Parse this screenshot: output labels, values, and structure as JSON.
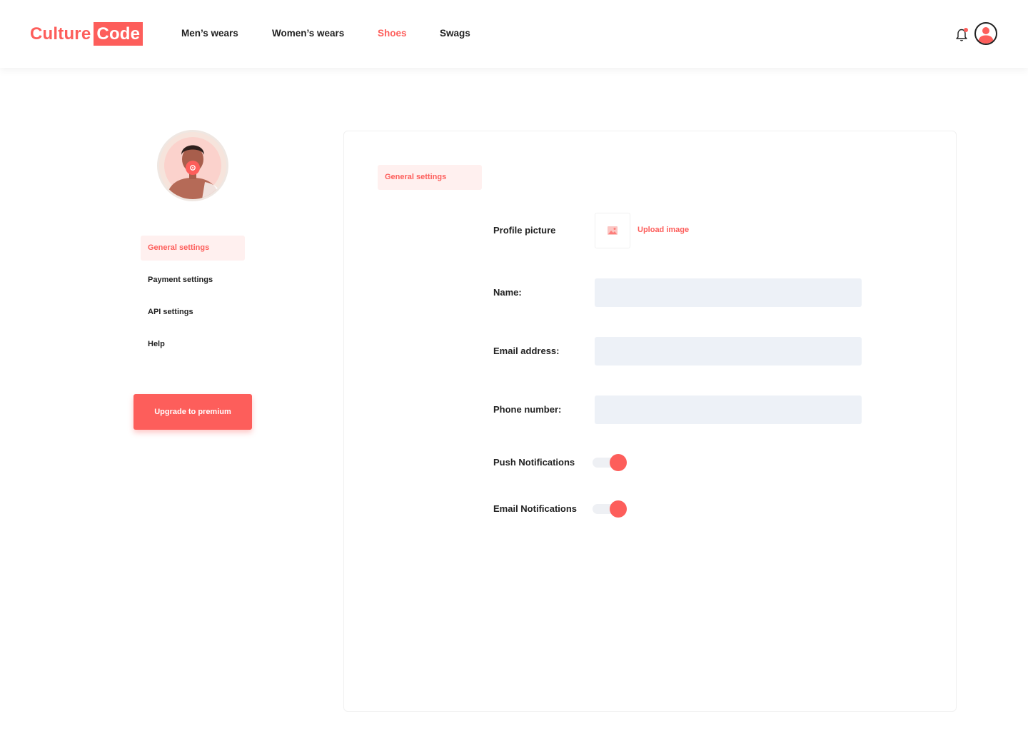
{
  "header": {
    "logo_part1": "Culture",
    "logo_part2": "Code",
    "nav": [
      {
        "label": "Men’s wears",
        "active": false
      },
      {
        "label": "Women’s wears",
        "active": false
      },
      {
        "label": "Shoes",
        "active": true
      },
      {
        "label": "Swags",
        "active": false
      }
    ],
    "icons": {
      "notification": "bell-icon",
      "account": "user-avatar-icon"
    },
    "has_unread_notification": true
  },
  "sidebar": {
    "items": [
      {
        "label": "General settings",
        "active": true
      },
      {
        "label": "Payment settings",
        "active": false
      },
      {
        "label": "API settings",
        "active": false
      },
      {
        "label": "Help",
        "active": false
      }
    ],
    "upgrade_label": "Upgrade to premium"
  },
  "main": {
    "tab_label": "General settings",
    "profile_picture_label": "Profile picture",
    "upload_label": "Upload image",
    "name_label": "Name:",
    "name_value": "",
    "email_label": "Email address:",
    "email_value": "",
    "phone_label": "Phone number:",
    "phone_value": "",
    "push_label": "Push Notifications",
    "push_enabled": true,
    "email_notif_label": "Email Notifications",
    "email_notif_enabled": true
  },
  "colors": {
    "accent": "#fd5e5b",
    "input_bg": "#edf1f7",
    "active_bg": "#fff0ef"
  }
}
